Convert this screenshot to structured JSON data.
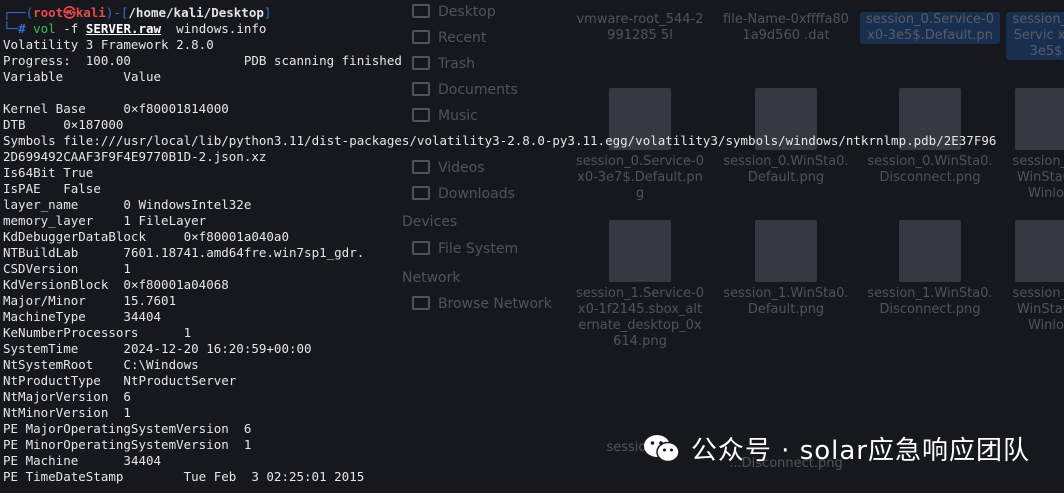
{
  "prompt": {
    "frame_open": "┌──(",
    "user": "root㉿kali",
    "frame_mid": ")-[",
    "path": "/home/kali/Desktop",
    "frame_close": "]",
    "frame_lower": "└─",
    "hash": "# ",
    "cmd_vol": "vol",
    "cmd_flag": " -f ",
    "cmd_file": "SERVER.raw",
    "cmd_plugin": "  windows.info"
  },
  "output_lines": [
    "Volatility 3 Framework 2.8.0",
    "Progress:  100.00\t\tPDB scanning finished",
    "Variable\tValue",
    "",
    "Kernel Base\t0×f80001814000",
    "DTB\t0×187000",
    "Symbols\tfile:///usr/local/lib/python3.11/dist-packages/volatility3-2.8.0-py3.11.egg/volatility3/symbols/windows/ntkrnlmp.pdb/2E37F96",
    "2D699492CAAF3F9F4E9770B1D-2.json.xz",
    "Is64Bit True",
    "IsPAE\tFalse",
    "layer_name\t0 WindowsIntel32e",
    "memory_layer\t1 FileLayer",
    "KdDebuggerDataBlock\t0×f80001a040a0",
    "NTBuildLab\t7601.18741.amd64fre.win7sp1_gdr.",
    "CSDVersion\t1",
    "KdVersionBlock\t0×f80001a04068",
    "Major/Minor\t15.7601",
    "MachineType\t34404",
    "KeNumberProcessors\t1",
    "SystemTime\t2024-12-20 16:20:59+00:00",
    "NtSystemRoot\tC:\\Windows",
    "NtProductType\tNtProductServer",
    "NtMajorVersion\t6",
    "NtMinorVersion\t1",
    "PE MajorOperatingSystemVersion\t6",
    "PE MinorOperatingSystemVersion\t1",
    "PE Machine\t34404",
    "PE TimeDateStamp\tTue Feb  3 02:25:01 2015"
  ],
  "background_file_manager": {
    "sidebar": [
      "Desktop",
      "Recent",
      "Trash",
      "Documents",
      "Music",
      "Videos",
      "Downloads"
    ],
    "sidebar_sections": [
      "Devices",
      "Network"
    ],
    "devices": [
      "File System"
    ],
    "network": [
      "Browse Network"
    ],
    "files_row1": [
      "vmware-root_544-2991285 5l",
      "file-Name-0xffffa801a9d560 .dat",
      "session_0.Service-0x0-3e5$.Default.pn",
      "session_0.Servic x0-3e5$"
    ],
    "files_row2": [
      "session_0.Service-0 x0-3e7$.Default.pn g",
      "session_0.WinSta0. Default.png",
      "session_0.WinSta0. Disconnect.png",
      "session_0.WinSta0. Winlo"
    ],
    "files_row3": [
      "session_1.Service-0 x0-1f2145.sbox_alt ernate_desktop_0x 614.png",
      "session_1.WinSta0. Default.png",
      "session_1.WinSta0. Disconnect.png",
      "session_1.WinSta0. Winlo"
    ],
    "files_row4": [
      "session_...",
      "...Disconnect.png"
    ]
  },
  "watermark": {
    "text": "公众号 · solar应急响应团队"
  },
  "colors": {
    "background": "#16181d",
    "prompt_frame": "#2e6fd6",
    "prompt_user": "#e84a4a",
    "command": "#3fbd5a",
    "text": "#e6e6e6"
  }
}
